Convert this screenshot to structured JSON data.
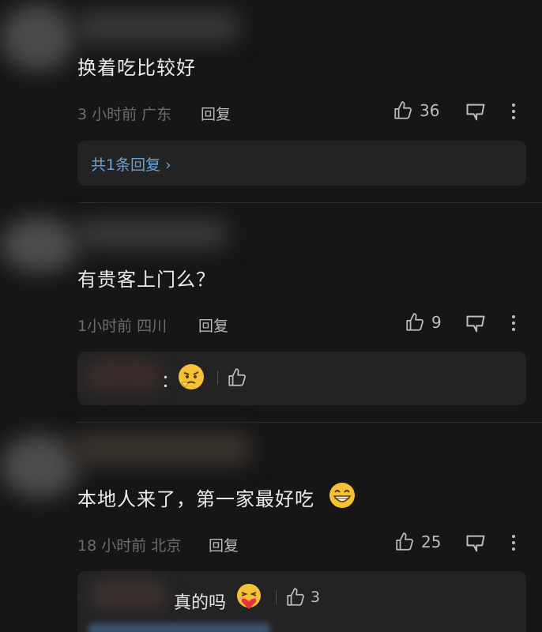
{
  "comments": [
    {
      "text": "换着吃比较好",
      "meta": "3 小时前 广东",
      "reply_label": "回复",
      "likes": "36",
      "reply_summary": "共1条回复 ›"
    },
    {
      "text": "有贵客上门么？",
      "meta": "1小时前 四川",
      "reply_label": "回复",
      "likes": "9",
      "reply_preview": {
        "separator": "：",
        "icon": "thinking-emoji-icon"
      }
    },
    {
      "text": "本地人来了，第一家最好吃",
      "meta": "18 小时前 北京",
      "reply_label": "回复",
      "likes": "25",
      "reply_preview": {
        "text": "真的吗",
        "likes": "3",
        "icon": "heart-hug-emoji-icon"
      }
    }
  ],
  "colors": {
    "background": "#161616",
    "reply_box": "#232323",
    "link_blue": "#6aa3d6",
    "meta_gray": "#6c6c6c"
  }
}
